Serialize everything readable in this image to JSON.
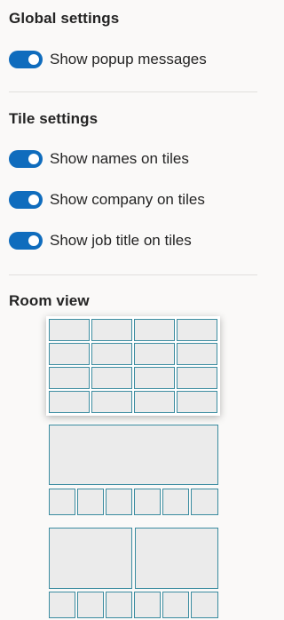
{
  "global": {
    "title": "Global settings",
    "toggles": [
      {
        "label": "Show popup messages",
        "on": true
      }
    ]
  },
  "tile": {
    "title": "Tile settings",
    "toggles": [
      {
        "label": "Show names on tiles",
        "on": true
      },
      {
        "label": "Show company on tiles",
        "on": true
      },
      {
        "label": "Show job title on tiles",
        "on": true
      }
    ]
  },
  "room_view": {
    "title": "Room view",
    "layouts": [
      {
        "name": "grid-4x4",
        "selected": true
      },
      {
        "name": "speaker-with-6-thumbnails",
        "selected": false
      },
      {
        "name": "two-speakers-with-6-thumbnails",
        "selected": false
      }
    ]
  },
  "colors": {
    "accent": "#0f6cbd",
    "cell_fill": "#ebebeb",
    "cell_border": "#3b8ca0",
    "divider": "#e1dfdd"
  }
}
